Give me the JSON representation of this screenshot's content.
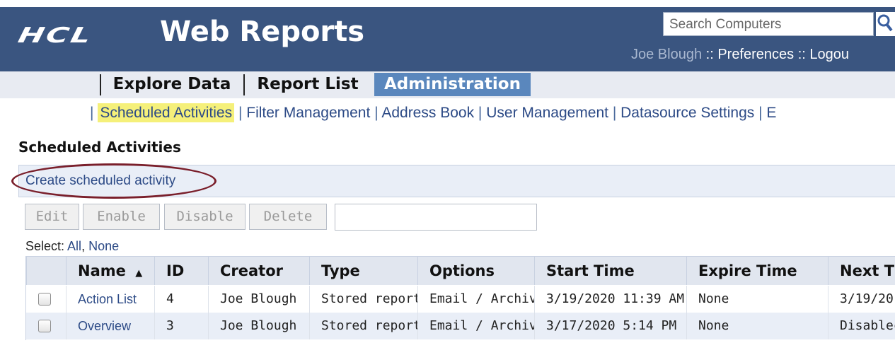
{
  "header": {
    "logo": "HCL",
    "title": "Web Reports",
    "search_placeholder": "Search Computers",
    "user": "Joe Blough",
    "separator": "::",
    "preferences": "Preferences",
    "logout": "Logou"
  },
  "nav": {
    "tabs": [
      {
        "label": "Explore Data",
        "active": false
      },
      {
        "label": "Report List",
        "active": false
      },
      {
        "label": "Administration",
        "active": true
      }
    ]
  },
  "subnav": {
    "items": [
      "Scheduled Activities",
      "Filter Management",
      "Address Book",
      "User Management",
      "Datasource Settings",
      "E"
    ],
    "separator": "|",
    "highlighted": "Scheduled Activities"
  },
  "section": {
    "title": "Scheduled Activities",
    "create_link": "Create scheduled activity"
  },
  "toolbar": {
    "edit": "Edit",
    "enable": "Enable",
    "disable": "Disable",
    "delete": "Delete"
  },
  "select": {
    "label": "Select:",
    "all": "All",
    "comma": ",",
    "none": "None"
  },
  "table": {
    "headers": [
      "Name",
      "ID",
      "Creator",
      "Type",
      "Options",
      "Start Time",
      "Expire Time",
      "Next T"
    ],
    "sort_indicator": "▲",
    "rows": [
      {
        "name": "Action List",
        "id": "4",
        "creator": "Joe Blough",
        "type": "Stored report",
        "options": "Email / Archive",
        "start": "3/19/2020 11:39 AM",
        "expire": "None",
        "next": "3/19/20"
      },
      {
        "name": "Overview",
        "id": "3",
        "creator": "Joe Blough",
        "type": "Stored report",
        "options": "Email / Archive",
        "start": "3/17/2020 5:14 PM",
        "expire": "None",
        "next": "Disablec"
      }
    ]
  },
  "colors": {
    "header_bg": "#3a5580",
    "active_tab": "#5a87bd",
    "link": "#2c4a86",
    "highlight": "#f5f07a",
    "annotation_oval": "#7a1f2b"
  }
}
